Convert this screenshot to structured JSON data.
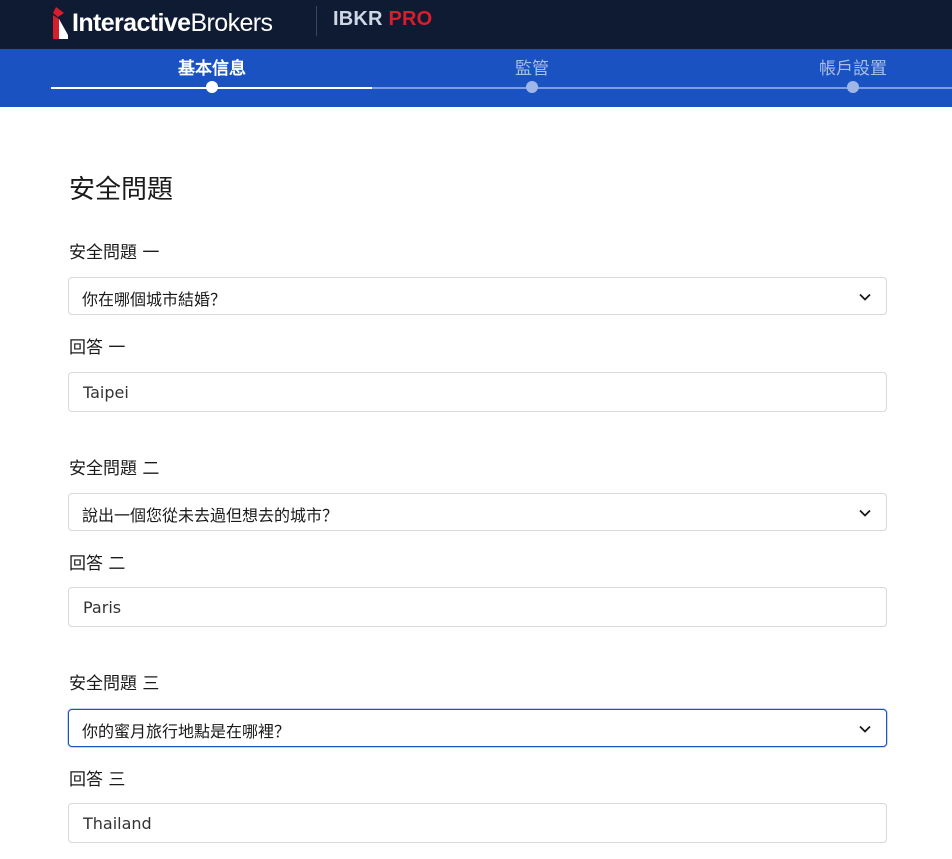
{
  "header": {
    "brand_bold": "Interactive",
    "brand_light": "Brokers",
    "product_a": "IBKR",
    "product_b": "PRO",
    "colors": {
      "topbar": "#0f1a33",
      "stepbar": "#1b52c2",
      "pro": "#d81e2c"
    }
  },
  "steps": [
    {
      "label": "基本信息",
      "state": "active"
    },
    {
      "label": "監管",
      "state": "todo"
    },
    {
      "label": "帳戶設置",
      "state": "todo"
    }
  ],
  "form": {
    "title": "安全問題",
    "q1": {
      "label": "安全問題 一",
      "value": "你在哪個城市結婚？",
      "answer_label": "回答 一",
      "answer": "Taipei"
    },
    "q2": {
      "label": "安全問題 二",
      "value": "說出一個您從未去過但想去的城市？",
      "answer_label": "回答 二",
      "answer": "Paris"
    },
    "q3": {
      "label": "安全問題 三",
      "value": "你的蜜月旅行地點是在哪裡？",
      "answer_label": "回答 三",
      "answer": "Thailand"
    }
  },
  "icons": {
    "dropdown": "chevron-down-icon",
    "logo": "ib-logo-icon"
  }
}
